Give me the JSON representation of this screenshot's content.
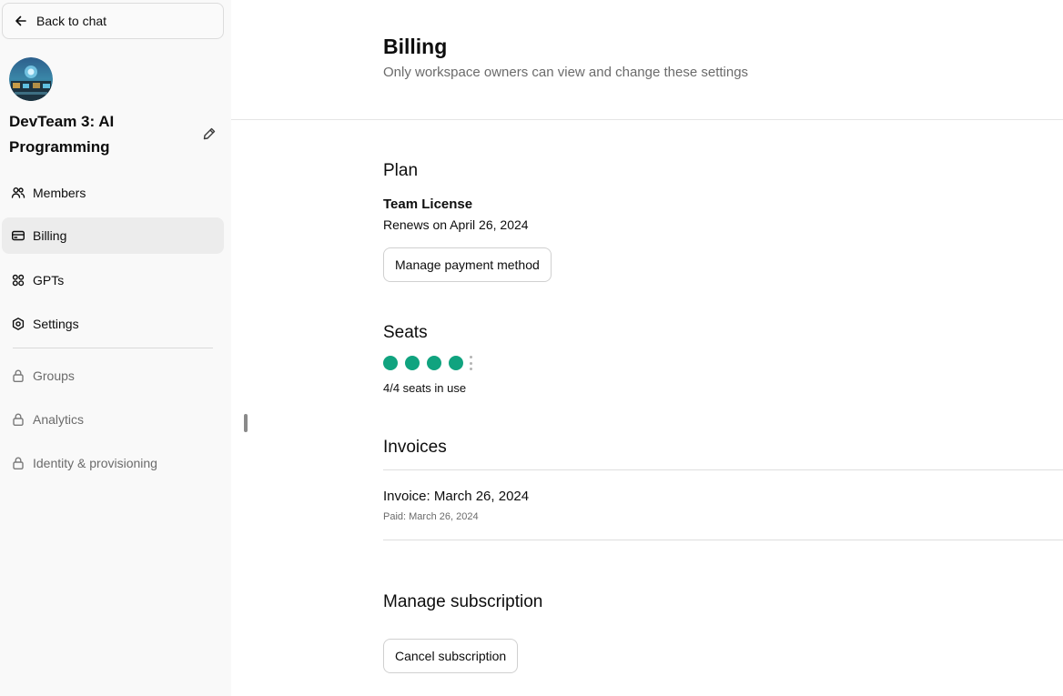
{
  "sidebar": {
    "back_label": "Back to chat",
    "workspace_name": "DevTeam 3: AI Programming",
    "nav": [
      {
        "label": "Members",
        "icon": "members-icon",
        "active": false,
        "locked": false
      },
      {
        "label": "Billing",
        "icon": "credit-card-icon",
        "active": true,
        "locked": false
      },
      {
        "label": "GPTs",
        "icon": "grid-icon",
        "active": false,
        "locked": false
      },
      {
        "label": "Settings",
        "icon": "gear-icon",
        "active": false,
        "locked": false
      },
      {
        "label": "Groups",
        "icon": "lock-icon",
        "active": false,
        "locked": true
      },
      {
        "label": "Analytics",
        "icon": "lock-icon",
        "active": false,
        "locked": true
      },
      {
        "label": "Identity & provisioning",
        "icon": "lock-icon",
        "active": false,
        "locked": true
      }
    ]
  },
  "header": {
    "title": "Billing",
    "subtitle": "Only workspace owners can view and change these settings"
  },
  "plan": {
    "heading": "Plan",
    "name": "Team License",
    "renews": "Renews on April 26, 2024",
    "manage_button": "Manage payment method"
  },
  "seats": {
    "heading": "Seats",
    "used": 4,
    "total": 4,
    "summary": "4/4 seats in use"
  },
  "invoices": {
    "heading": "Invoices",
    "items": [
      {
        "title": "Invoice: March 26, 2024",
        "status": "Paid: March 26, 2024"
      }
    ]
  },
  "subscription": {
    "heading": "Manage subscription",
    "cancel_button": "Cancel subscription"
  },
  "colors": {
    "accent": "#10a37f",
    "active_nav": "#ececec",
    "sidebar_bg": "#f9f9f9"
  }
}
